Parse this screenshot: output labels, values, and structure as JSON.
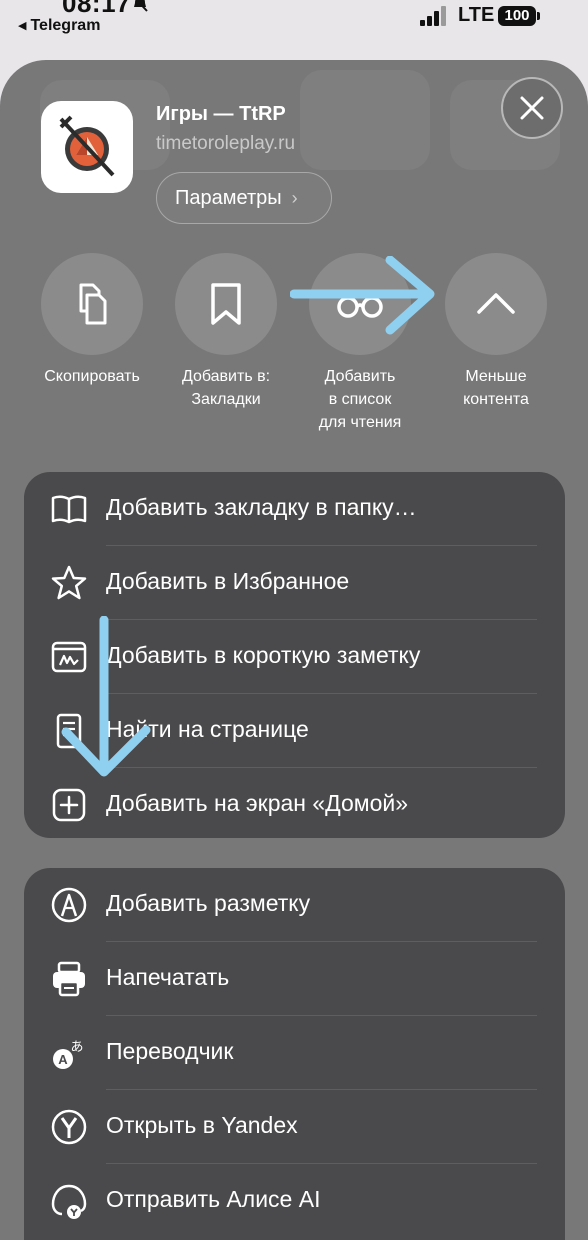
{
  "status_bar": {
    "time": "08:17",
    "back_app": "Telegram",
    "network": "LTE",
    "battery": "100"
  },
  "header": {
    "site_title": "Игры — TtRP",
    "site_url": "timetoroleplay.ru",
    "params_label": "Параметры",
    "params_chevron": "›"
  },
  "actions": [
    {
      "label": "Скопировать",
      "icon": "copy-icon"
    },
    {
      "label": "Добавить в:\nЗакладки",
      "icon": "bookmark-icon"
    },
    {
      "label": "Добавить\nв список\nдля чтения",
      "icon": "glasses-icon"
    },
    {
      "label": "Меньше\nконтента",
      "icon": "chevron-up-icon"
    }
  ],
  "menu_group_1": [
    {
      "label": "Добавить закладку в папку…",
      "icon": "book-icon"
    },
    {
      "label": "Добавить в Избранное",
      "icon": "star-icon"
    },
    {
      "label": "Добавить в короткую заметку",
      "icon": "quick-note-icon"
    },
    {
      "label": "Найти на странице",
      "icon": "find-document-icon"
    },
    {
      "label": "Добавить на экран «Домой»",
      "icon": "plus-square-icon"
    }
  ],
  "menu_group_2": [
    {
      "label": "Добавить разметку",
      "icon": "markup-pen-icon"
    },
    {
      "label": "Напечатать",
      "icon": "printer-icon"
    },
    {
      "label": "Переводчик",
      "icon": "translate-icon"
    },
    {
      "label": "Открыть в Yandex",
      "icon": "yandex-icon"
    },
    {
      "label": "Отправить Алисе AI",
      "icon": "alice-icon"
    }
  ],
  "colors": {
    "sheet": "#787878",
    "menu_group": "#4a4a4c",
    "annotation_arrow": "#8fd0f0"
  }
}
